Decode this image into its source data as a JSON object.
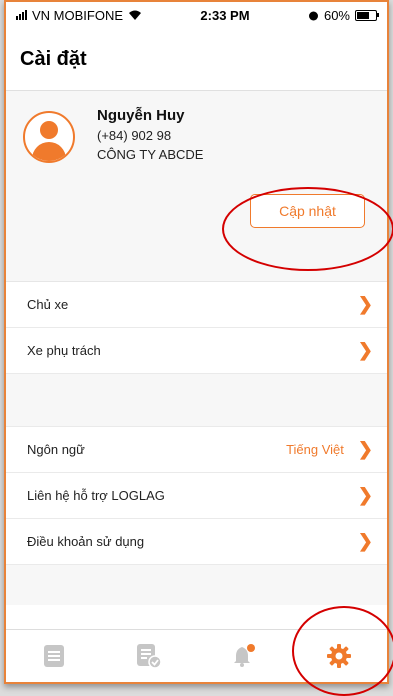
{
  "status": {
    "carrier": "VN MOBIFONE",
    "time": "2:33 PM",
    "battery": "60%"
  },
  "header": {
    "title": "Cài đặt"
  },
  "profile": {
    "name": "Nguyễn Huy",
    "phone": "(+84) 902 98",
    "company": "CÔNG TY ABCDE",
    "update_label": "Cập nhật"
  },
  "sections": [
    {
      "label": "Chủ xe"
    },
    {
      "label": "Xe phụ trách"
    }
  ],
  "settings": [
    {
      "label": "Ngôn ngữ",
      "value": "Tiếng Việt"
    },
    {
      "label": "Liên hệ hỗ trợ LOGLAG"
    },
    {
      "label": "Điều khoản sử dụng"
    }
  ],
  "tabs": [
    {
      "icon": "list-icon",
      "active": false
    },
    {
      "icon": "checklist-icon",
      "active": false
    },
    {
      "icon": "bell-icon",
      "active": false,
      "badge": true
    },
    {
      "icon": "gear-icon",
      "active": true
    }
  ],
  "colors": {
    "accent": "#f07a2c",
    "inactive": "#c6c6c6",
    "annotation": "#d40000"
  }
}
